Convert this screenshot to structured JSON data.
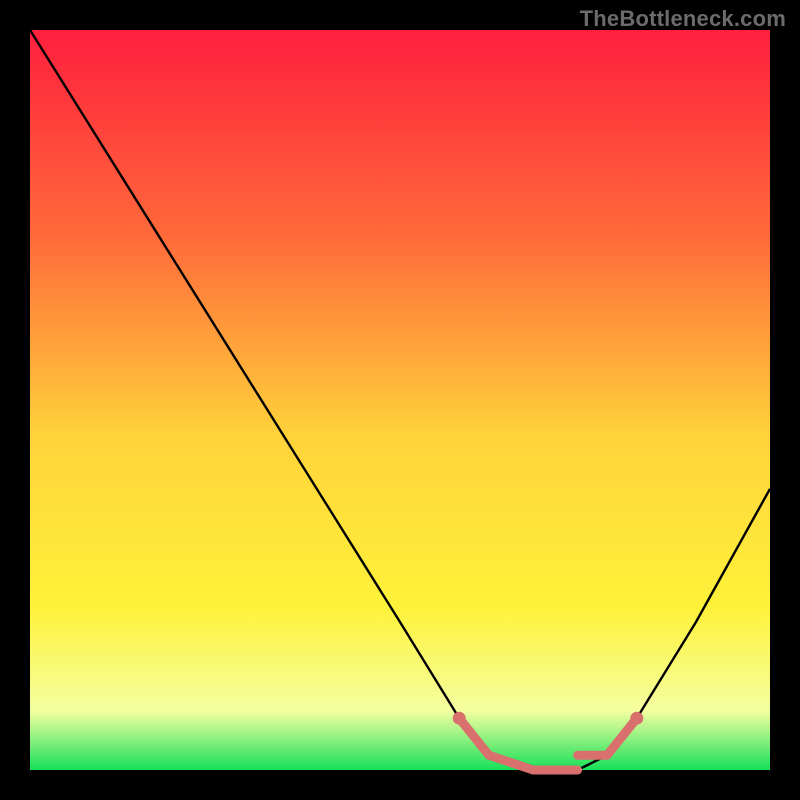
{
  "watermark": "TheBottleneck.com",
  "colors": {
    "frame": "#000000",
    "gradient_top": "#ff1f3e",
    "gradient_mid_upper": "#ff6a3a",
    "gradient_mid": "#ffd33a",
    "gradient_mid_lower": "#fff23a",
    "gradient_lower": "#f4ffa0",
    "gradient_bottom": "#18e05a",
    "curve": "#000000",
    "highlight": "#d9706e"
  },
  "chart_data": {
    "type": "line",
    "title": "",
    "xlabel": "",
    "ylabel": "",
    "xlim": [
      0,
      100
    ],
    "ylim": [
      0,
      100
    ],
    "series": [
      {
        "name": "bottleneck-curve",
        "x": [
          0,
          10,
          20,
          30,
          40,
          50,
          58,
          62,
          68,
          74,
          78,
          82,
          90,
          100
        ],
        "y": [
          100,
          84,
          68,
          52,
          36,
          20,
          7,
          2,
          0,
          0,
          2,
          7,
          20,
          38
        ]
      }
    ],
    "highlight_segments": [
      {
        "x0": 58,
        "y0": 7,
        "x1": 62,
        "y1": 2
      },
      {
        "x0": 62,
        "y0": 2,
        "x1": 68,
        "y1": 0
      },
      {
        "x0": 68,
        "y0": 0,
        "x1": 74,
        "y1": 0
      },
      {
        "x0": 74,
        "y0": 2,
        "x1": 78,
        "y1": 2
      },
      {
        "x0": 78,
        "y0": 2,
        "x1": 82,
        "y1": 7
      }
    ],
    "highlight_points": [
      {
        "x": 58,
        "y": 7
      },
      {
        "x": 82,
        "y": 7
      }
    ]
  }
}
